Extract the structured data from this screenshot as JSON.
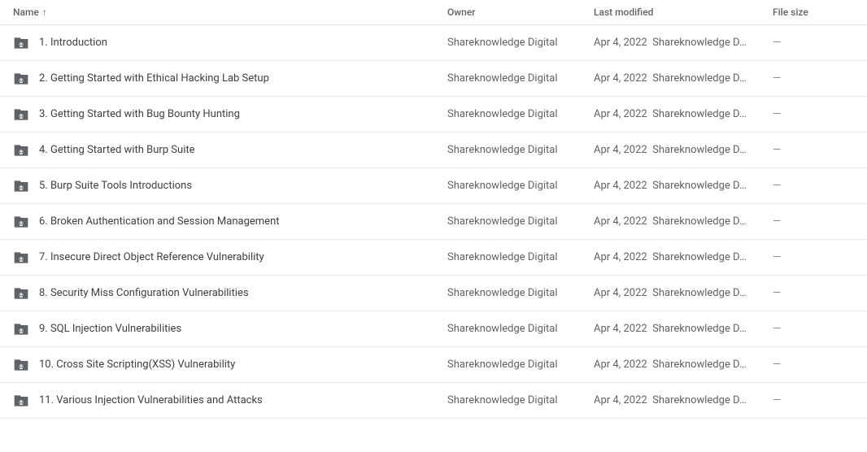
{
  "header": {
    "columns": {
      "name": "Name",
      "owner": "Owner",
      "last_modified": "Last modified",
      "file_size": "File size"
    },
    "sort_icon": "↑"
  },
  "rows": [
    {
      "id": 1,
      "name": "1. Introduction",
      "owner": "Shareknowledge Digital",
      "modified": "Apr 4, 2022",
      "modifier": "Shareknowledge D…",
      "size": "—"
    },
    {
      "id": 2,
      "name": "2. Getting Started with Ethical Hacking Lab Setup",
      "owner": "Shareknowledge Digital",
      "modified": "Apr 4, 2022",
      "modifier": "Shareknowledge D…",
      "size": "—"
    },
    {
      "id": 3,
      "name": "3. Getting Started with Bug Bounty Hunting",
      "owner": "Shareknowledge Digital",
      "modified": "Apr 4, 2022",
      "modifier": "Shareknowledge D…",
      "size": "—"
    },
    {
      "id": 4,
      "name": "4. Getting Started with Burp Suite",
      "owner": "Shareknowledge Digital",
      "modified": "Apr 4, 2022",
      "modifier": "Shareknowledge D…",
      "size": "—"
    },
    {
      "id": 5,
      "name": "5. Burp Suite Tools Introductions",
      "owner": "Shareknowledge Digital",
      "modified": "Apr 4, 2022",
      "modifier": "Shareknowledge D…",
      "size": "—"
    },
    {
      "id": 6,
      "name": "6. Broken Authentication and Session Management",
      "owner": "Shareknowledge Digital",
      "modified": "Apr 4, 2022",
      "modifier": "Shareknowledge D…",
      "size": "—"
    },
    {
      "id": 7,
      "name": "7. Insecure Direct Object Reference Vulnerability",
      "owner": "Shareknowledge Digital",
      "modified": "Apr 4, 2022",
      "modifier": "Shareknowledge D…",
      "size": "—"
    },
    {
      "id": 8,
      "name": "8. Security Miss Configuration  Vulnerabilities",
      "owner": "Shareknowledge Digital",
      "modified": "Apr 4, 2022",
      "modifier": "Shareknowledge D…",
      "size": "—"
    },
    {
      "id": 9,
      "name": "9. SQL Injection Vulnerabilities",
      "owner": "Shareknowledge Digital",
      "modified": "Apr 4, 2022",
      "modifier": "Shareknowledge D…",
      "size": "—"
    },
    {
      "id": 10,
      "name": "10. Cross Site Scripting(XSS) Vulnerability",
      "owner": "Shareknowledge Digital",
      "modified": "Apr 4, 2022",
      "modifier": "Shareknowledge D…",
      "size": "—"
    },
    {
      "id": 11,
      "name": "11. Various Injection Vulnerabilities and Attacks",
      "owner": "Shareknowledge Digital",
      "modified": "Apr 4, 2022",
      "modifier": "Shareknowledge D…",
      "size": "—"
    }
  ],
  "colors": {
    "folder_icon": "#5f6368",
    "folder_shared": "#4a90d9",
    "border": "#e0e0e0",
    "header_text": "#5f6368",
    "row_text": "#3c4043",
    "secondary_text": "#5f6368"
  }
}
